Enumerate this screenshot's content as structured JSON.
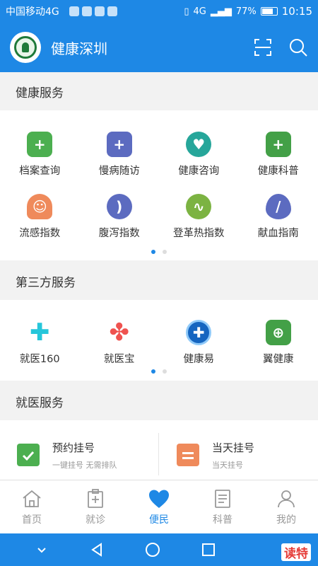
{
  "status_bar": {
    "carrier": "中国移动4G",
    "network": "4G",
    "battery": "77%",
    "time": "10:15"
  },
  "app_bar": {
    "title": "健康深圳",
    "scan_icon": "scan-icon",
    "search_icon": "search-icon"
  },
  "health_services": {
    "heading": "健康服务",
    "row1": [
      {
        "label": "档案查询",
        "icon": "record-icon",
        "color": "#4caf50"
      },
      {
        "label": "慢病随访",
        "icon": "medical-bag-icon",
        "color": "#5c6bc0"
      },
      {
        "label": "健康咨询",
        "icon": "heart-chat-icon",
        "color": "#26a69a"
      },
      {
        "label": "健康科普",
        "icon": "document-plus-icon",
        "color": "#43a047"
      }
    ],
    "row2": [
      {
        "label": "流感指数",
        "icon": "flu-icon",
        "color": "#ef8a5b"
      },
      {
        "label": "腹泻指数",
        "icon": "stomach-icon",
        "color": "#5c6bc0"
      },
      {
        "label": "登革热指数",
        "icon": "pulse-icon",
        "color": "#7cb342"
      },
      {
        "label": "献血指南",
        "icon": "blood-drop-icon",
        "color": "#5c6bc0"
      }
    ]
  },
  "third_party": {
    "heading": "第三方服务",
    "items": [
      {
        "label": "就医160",
        "icon": "cross-logo-icon",
        "color": "#26c6da"
      },
      {
        "label": "就医宝",
        "icon": "flower-cross-icon",
        "color": "#ef5350"
      },
      {
        "label": "健康易",
        "icon": "round-badge-icon",
        "color": "#1565c0"
      },
      {
        "label": "翼健康",
        "icon": "green-cross-icon",
        "color": "#43a047"
      }
    ]
  },
  "medical_services": {
    "heading": "就医服务",
    "cards": [
      {
        "title": "预约挂号",
        "subtitle": "一键挂号 无需排队",
        "icon": "calendar-check-icon",
        "color": "#4caf50"
      },
      {
        "title": "当天挂号",
        "subtitle": "当天挂号",
        "icon": "calendar-today-icon",
        "color": "#ef8a5b"
      }
    ]
  },
  "tab_bar": {
    "tabs": [
      {
        "label": "首页",
        "icon": "home-icon"
      },
      {
        "label": "就诊",
        "icon": "clipboard-plus-icon"
      },
      {
        "label": "便民",
        "icon": "heart-icon"
      },
      {
        "label": "科普",
        "icon": "article-icon"
      },
      {
        "label": "我的",
        "icon": "person-icon"
      }
    ]
  },
  "watermark": {
    "text": "读特"
  },
  "colors": {
    "primary": "#1e88e5",
    "inactive": "#999999"
  }
}
